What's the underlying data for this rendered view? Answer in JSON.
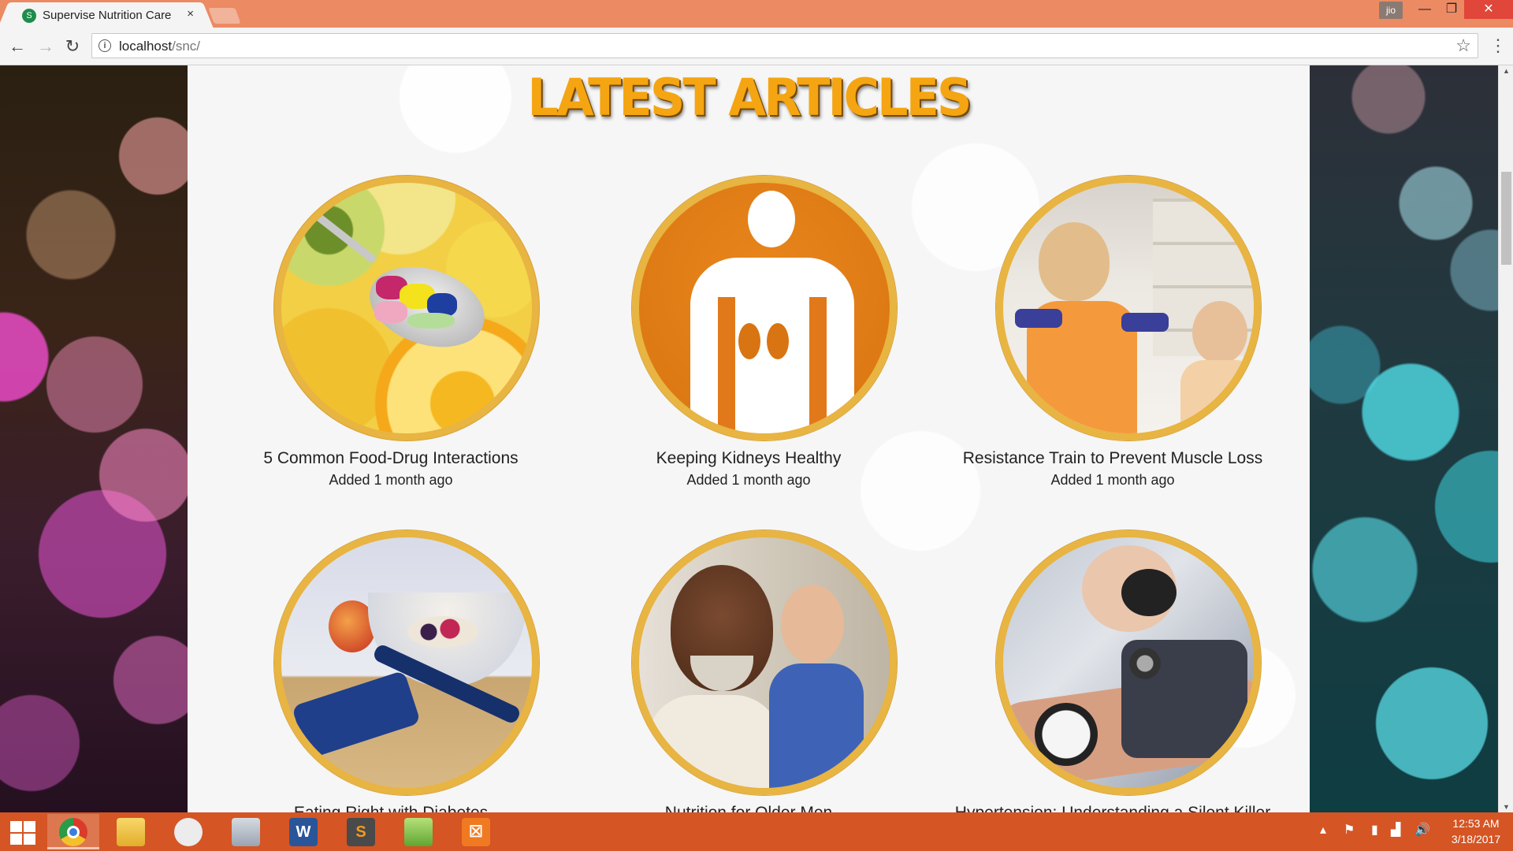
{
  "browser": {
    "tab_title": "Supervise Nutrition Care",
    "tab_close": "×",
    "favicon_letter": "S",
    "profile_label": "jio",
    "url_host": "localhost",
    "url_path": "/snc/",
    "win_min": "—",
    "win_max": "❐",
    "win_close": "✕"
  },
  "page": {
    "heading": "LATEST ARTICLES",
    "articles": [
      {
        "title": "5 Common Food-Drug Interactions",
        "date": "Added 1 month ago",
        "image": "pills-on-spoon-citrus"
      },
      {
        "title": "Keeping Kidneys Healthy",
        "date": "Added 1 month ago",
        "image": "kidney-body-icon"
      },
      {
        "title": "Resistance Train to Prevent Muscle Loss",
        "date": "Added 1 month ago",
        "image": "women-lifting-dumbbells"
      },
      {
        "title": "Eating Right with Diabetes",
        "image": "insulin-pen-fruit-bowl"
      },
      {
        "title": "Nutrition for Older Men",
        "image": "smiling-older-men"
      },
      {
        "title": "Hypertension: Understanding a Silent Killer",
        "image": "blood-pressure-cuff"
      }
    ]
  },
  "taskbar": {
    "apps": [
      "Chrome",
      "File Explorer",
      "Snipping Tool",
      "Calculator",
      "Word",
      "Sublime Text",
      "Notepad++",
      "XAMPP"
    ],
    "clock_time": "12:53 AM",
    "clock_date": "3/18/2017"
  },
  "colors": {
    "accent_orange": "#f4a511",
    "circle_border": "#e8b442",
    "taskbar": "#d55524",
    "titlebar": "#ec8a63"
  }
}
